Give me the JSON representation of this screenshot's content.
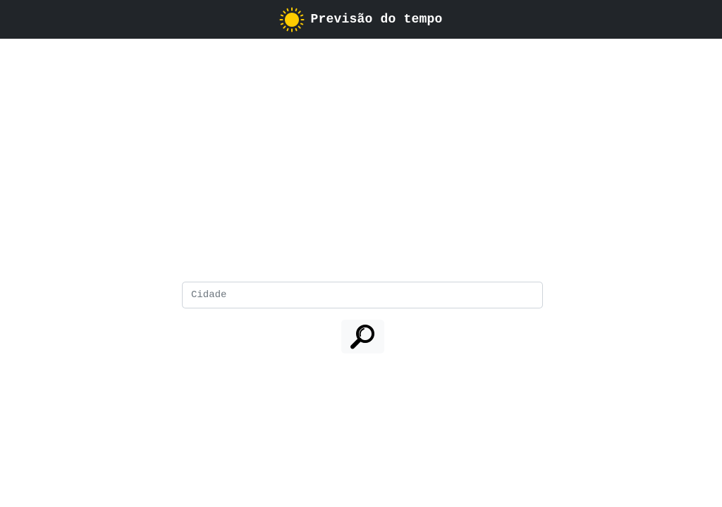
{
  "header": {
    "title": "Previsão do tempo",
    "logo_icon": "sun-icon",
    "background_color": "#212529",
    "logo_color": "#ffcc00"
  },
  "search": {
    "placeholder": "Cidade",
    "value": "",
    "button_icon": "search-icon"
  }
}
